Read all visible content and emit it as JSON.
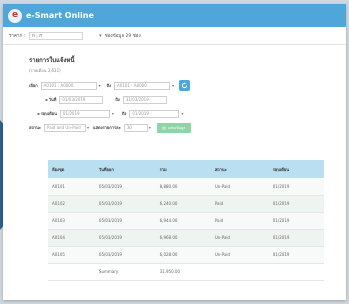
{
  "app": {
    "title": "e-Smart Online",
    "logo_letter": "e"
  },
  "topbar": {
    "filter_label": "ราคาก :",
    "filter_value": "ก ; ก",
    "dropdown_text": "ช่องข้อมูล 29 ช่อง"
  },
  "page": {
    "title": "รายการใบแจ้งหนี้",
    "subtitle": "(รายเดือน 3,611)"
  },
  "filters": {
    "from_label": "เลือก",
    "from_value": "A0101 : A0000",
    "to_label": "ถึง",
    "to_value": "A0101 : A0000",
    "start_date_label": "วันที่",
    "start_date_value": "01/03/2019",
    "end_date_label": "ถึง",
    "end_date_value": "31/03/2019",
    "month_label": "รอบเดือน",
    "month_value": "01/2019",
    "month_to_label": "ถึง",
    "month_to_value": "01/2019",
    "status_label": "สถานะ",
    "status_value": "Paid and Un-Paid",
    "page_size_label": "แสดงรายการละ",
    "page_size_value": "30",
    "green_button_label": "แสดงข้อมูล"
  },
  "table": {
    "headers": [
      "ห้องชุด",
      "วันที่ออก",
      "รวม",
      "สถานะ",
      "รอบเดือน"
    ],
    "rows": [
      [
        "A0101",
        "05/03/2019",
        "8,880.00",
        "Un-Paid",
        "01/2019"
      ],
      [
        "A0102",
        "05/03/2019",
        "6,240.00",
        "Paid",
        "01/2019"
      ],
      [
        "A0103",
        "05/03/2019",
        "6,944.00",
        "Paid",
        "01/2019"
      ],
      [
        "A0104",
        "05/03/2019",
        "6,968.00",
        "Un-Paid",
        "01/2019"
      ],
      [
        "A0105",
        "05/03/2019",
        "6,028.00",
        "Un-Paid",
        "01/2019"
      ]
    ],
    "summary_label": "Summary",
    "summary_value": "31,950.00"
  }
}
